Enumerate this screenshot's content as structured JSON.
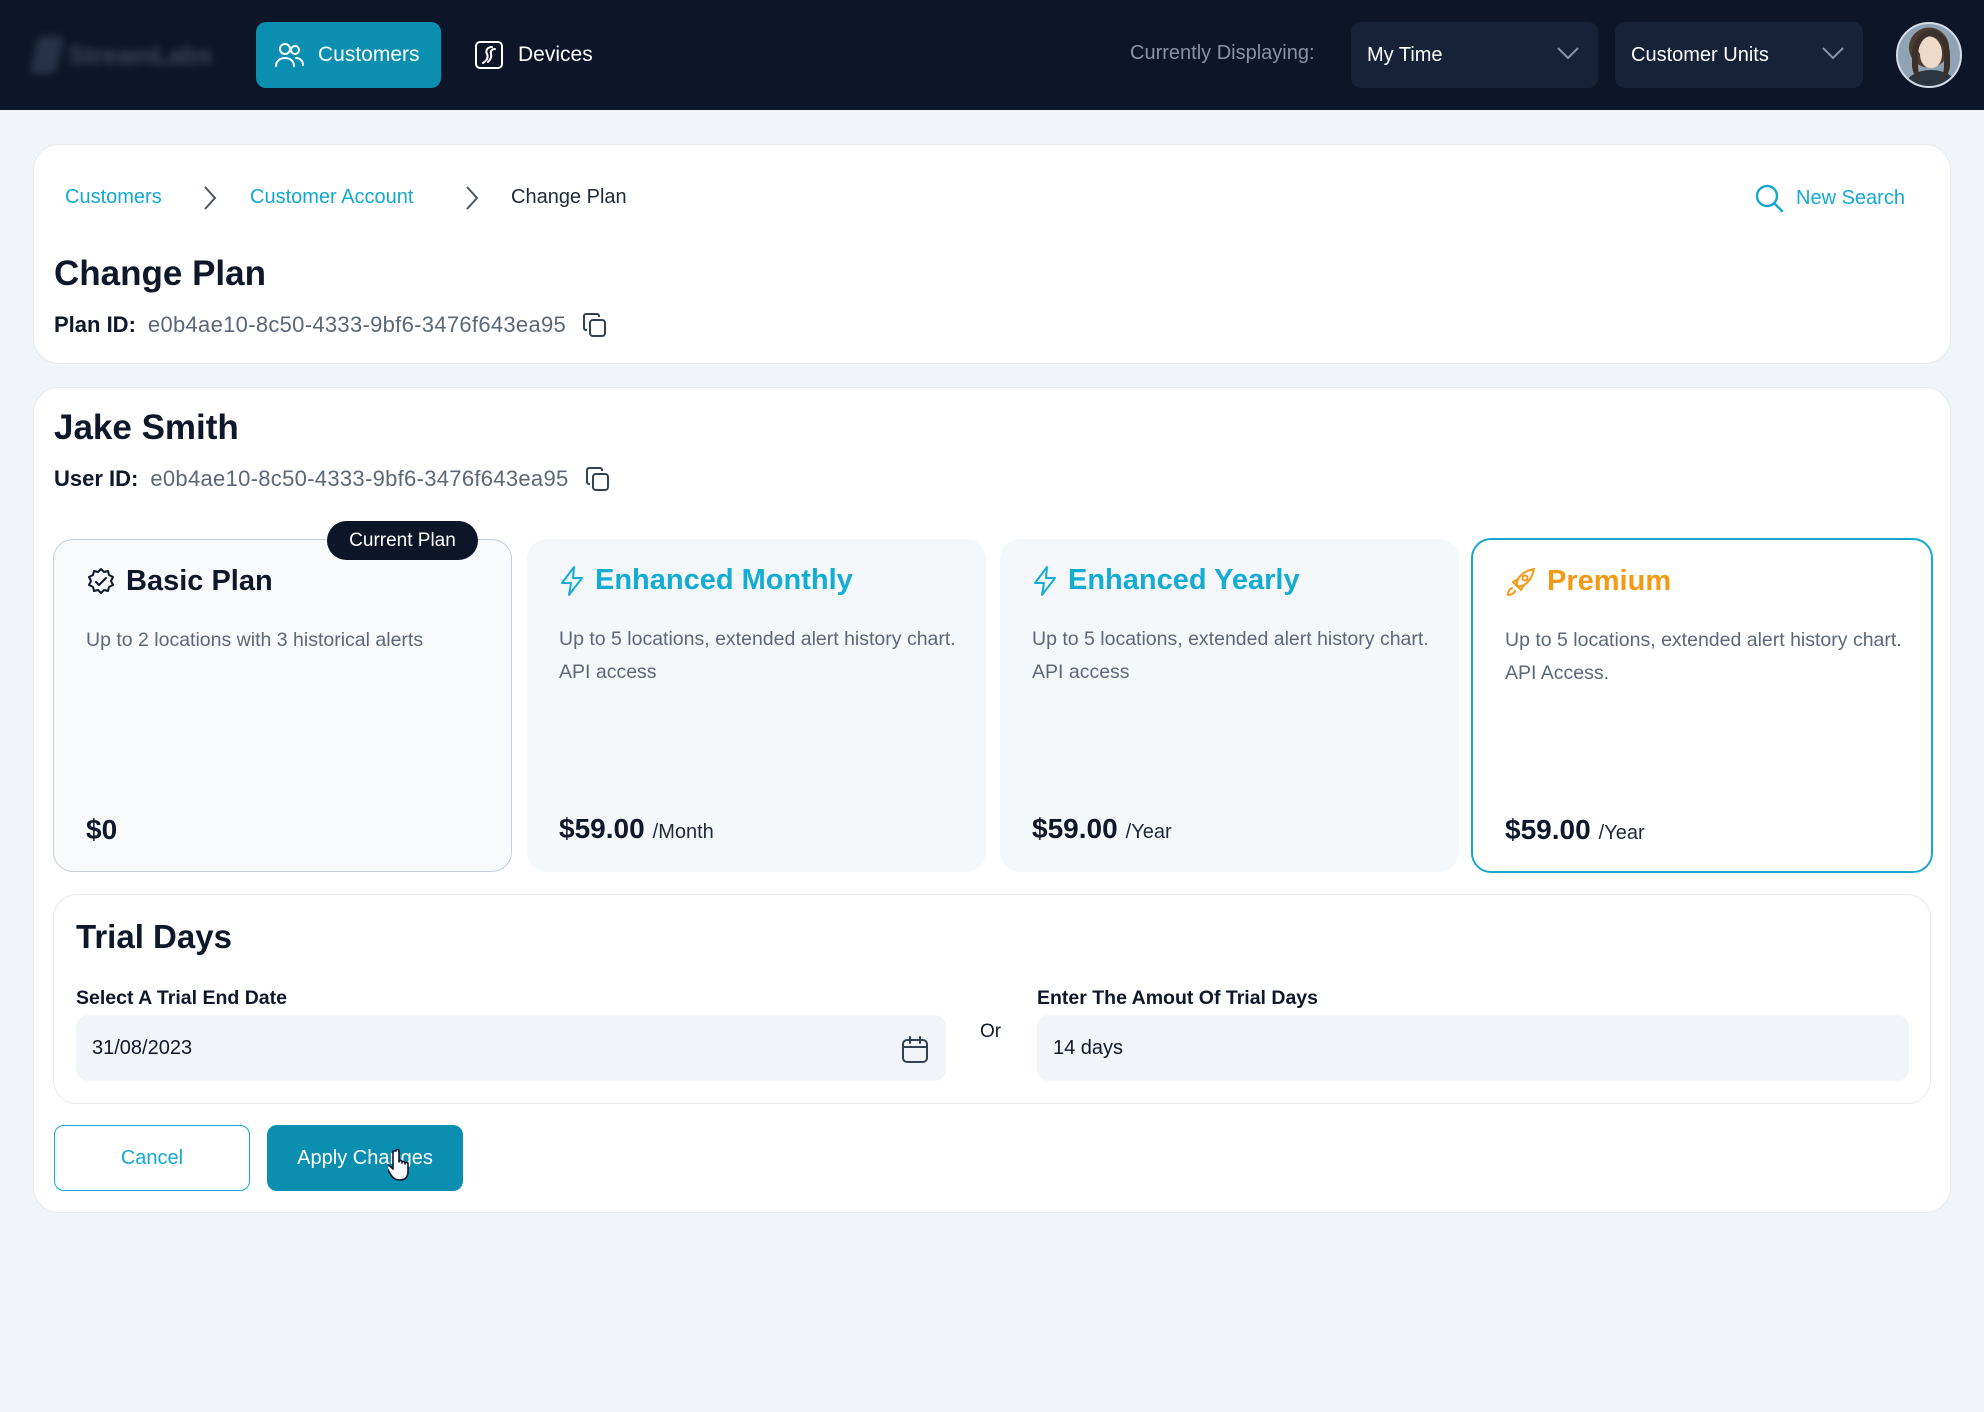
{
  "app": {
    "logo_text": "StreamLabs"
  },
  "nav": {
    "customers_label": "Customers",
    "devices_label": "Devices",
    "currently_displaying_label": "Currently Displaying:",
    "time_select_value": "My Time",
    "units_select_value": "Customer Units"
  },
  "breadcrumb": {
    "items": [
      "Customers",
      "Customer Account",
      "Change Plan"
    ]
  },
  "new_search_label": "New Search",
  "page": {
    "title": "Change Plan",
    "plan_id_label": "Plan ID:",
    "plan_id_value": "e0b4ae10-8c50-4333-9bf6-3476f643ea95"
  },
  "customer": {
    "name": "Jake Smith",
    "user_id_label": "User ID:",
    "user_id_value": "e0b4ae10-8c50-4333-9bf6-3476f643ea95"
  },
  "plans": [
    {
      "name": "Basic Plan",
      "description": "Up to 2 locations with 3 historical alerts",
      "price": "$0",
      "period": "",
      "badge": "Current Plan",
      "icon": "check-badge-icon",
      "color": "#0f172a"
    },
    {
      "name": "Enhanced Monthly",
      "description": "Up to 5 locations, extended alert history chart. API access",
      "price": "$59.00",
      "period": "/Month",
      "icon": "lightning-icon",
      "color": "#15acd4"
    },
    {
      "name": "Enhanced Yearly",
      "description": "Up to 5 locations, extended alert history chart. API access",
      "price": "$59.00",
      "period": "/Year",
      "icon": "lightning-icon",
      "color": "#15acd4"
    },
    {
      "name": "Premium",
      "description": "Up to 5 locations, extended alert history chart. API Access.",
      "price": "$59.00",
      "period": "/Year",
      "icon": "rocket-icon",
      "color": "#f29a16",
      "selected": true
    }
  ],
  "trial": {
    "title": "Trial Days",
    "end_date_label": "Select A Trial End Date",
    "end_date_value": "31/08/2023",
    "or_label": "Or",
    "days_label": "Enter The Amout Of Trial Days",
    "days_value": "14 days"
  },
  "actions": {
    "cancel_label": "Cancel",
    "apply_label": "Apply Changes"
  },
  "colors": {
    "accent": "#0b8fb0",
    "link": "#14a9d0",
    "premium": "#f29a16",
    "nav_bg": "#0c1628"
  }
}
